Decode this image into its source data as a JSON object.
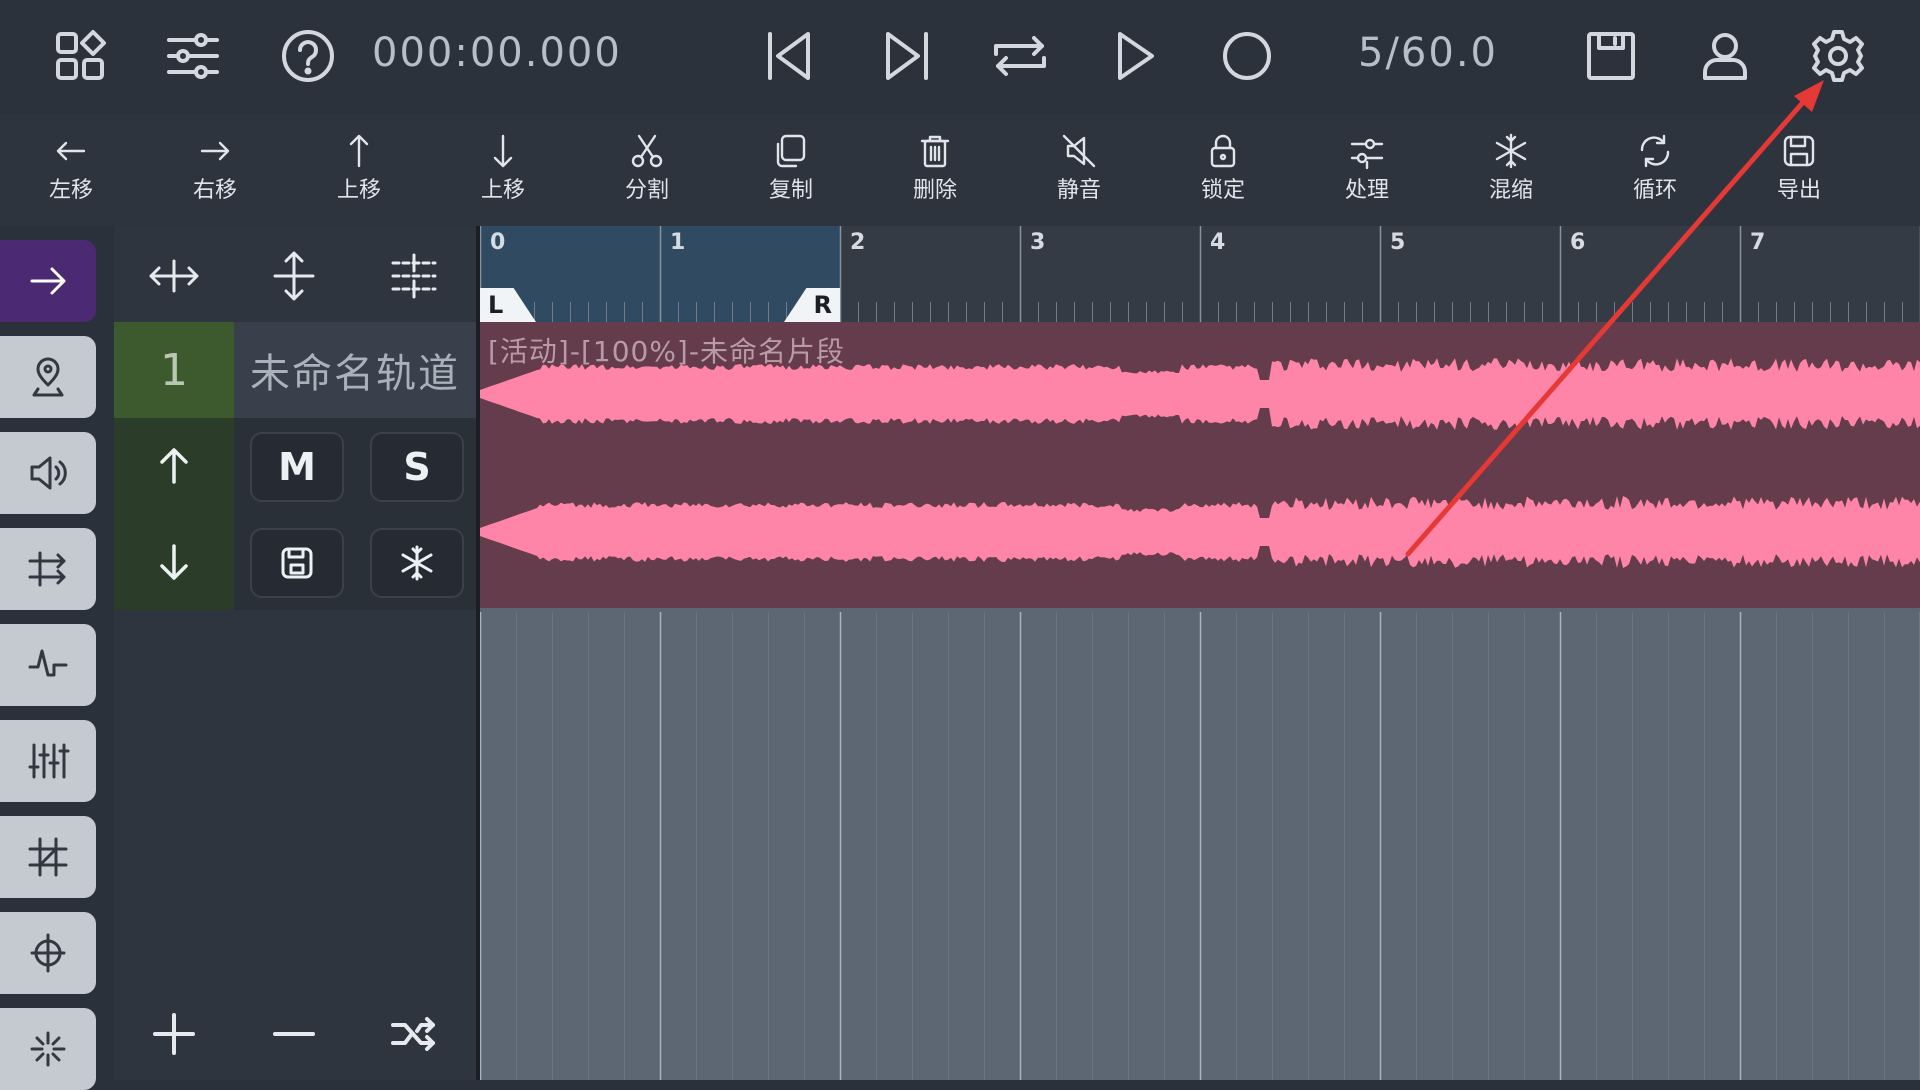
{
  "topbar": {
    "time": "000:00.000",
    "ratio": "5/60.0",
    "icons": [
      "apps-icon",
      "sliders-icon",
      "help-icon",
      "skip-start-icon",
      "skip-end-icon",
      "repeat-icon",
      "play-icon",
      "record-icon",
      "save-icon",
      "user-icon",
      "gear-icon"
    ]
  },
  "toolbar": {
    "items": [
      {
        "label": "左移",
        "icon": "arrow-left-icon"
      },
      {
        "label": "右移",
        "icon": "arrow-right-icon"
      },
      {
        "label": "上移",
        "icon": "arrow-up-icon"
      },
      {
        "label": "上移",
        "icon": "arrow-down-icon"
      },
      {
        "label": "分割",
        "icon": "scissors-icon"
      },
      {
        "label": "复制",
        "icon": "copy-icon"
      },
      {
        "label": "删除",
        "icon": "trash-icon"
      },
      {
        "label": "静音",
        "icon": "mute-icon"
      },
      {
        "label": "锁定",
        "icon": "lock-icon"
      },
      {
        "label": "处理",
        "icon": "adjust-icon"
      },
      {
        "label": "混缩",
        "icon": "snowflake-icon"
      },
      {
        "label": "循环",
        "icon": "loop-icon"
      },
      {
        "label": "导出",
        "icon": "export-save-icon"
      }
    ]
  },
  "track": {
    "number": "1",
    "name": "未命名轨道",
    "mute_label": "M",
    "solo_label": "S"
  },
  "ruler": {
    "labels": [
      "0",
      "1",
      "2",
      "3",
      "4",
      "5",
      "6",
      "7"
    ],
    "loop_start_label": "L",
    "loop_end_label": "R"
  },
  "clip": {
    "title": "[活动]-[100%]-未命名片段",
    "color": "#ff85a8"
  },
  "colors": {
    "accent_purple": "#4b2a73",
    "clip_bg": "#653c4b",
    "wave": "#ff85a8",
    "annotation_arrow": "#e53935"
  }
}
